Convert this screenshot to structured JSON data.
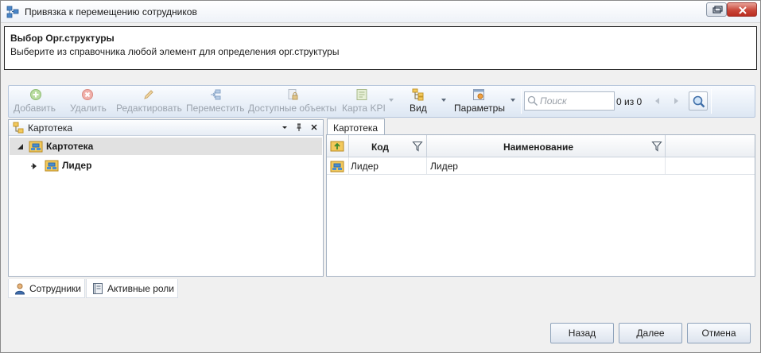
{
  "window": {
    "title": "Привязка к перемещению сотрудников"
  },
  "header": {
    "title": "Выбор Орг.структуры",
    "description": "Выберите из справочника любой элемент для определения орг.структуры"
  },
  "toolbar": {
    "add_label": "Добавить",
    "delete_label": "Удалить",
    "edit_label": "Редактировать",
    "move_label": "Переместить",
    "available_label": "Доступные объекты",
    "kpi_label": "Карта KPI",
    "view_label": "Вид",
    "params_label": "Параметры",
    "search_placeholder": "Поиск",
    "count_text": "0 из 0"
  },
  "left_pane": {
    "title": "Картотека",
    "tree": [
      {
        "label": "Картотека",
        "expanded": true,
        "selected": true
      },
      {
        "label": "Лидер",
        "expanded": false,
        "selected": false
      }
    ]
  },
  "bottom_tabs": [
    {
      "label": "Сотрудники",
      "icon": "person-icon"
    },
    {
      "label": "Активные роли",
      "icon": "book-icon"
    }
  ],
  "right_pane": {
    "tab_label": "Картотека",
    "columns": [
      "Код",
      "Наименование"
    ],
    "rows": [
      {
        "code": "Лидер",
        "name": "Лидер"
      }
    ]
  },
  "footer": {
    "back_label": "Назад",
    "next_label": "Далее",
    "cancel_label": "Отмена"
  },
  "colors": {
    "toolbar_bg": "#dde7f3",
    "selection_bg": "#e1e1e1",
    "close_button": "#c9473a",
    "disabled_text": "#9ba3ad"
  }
}
